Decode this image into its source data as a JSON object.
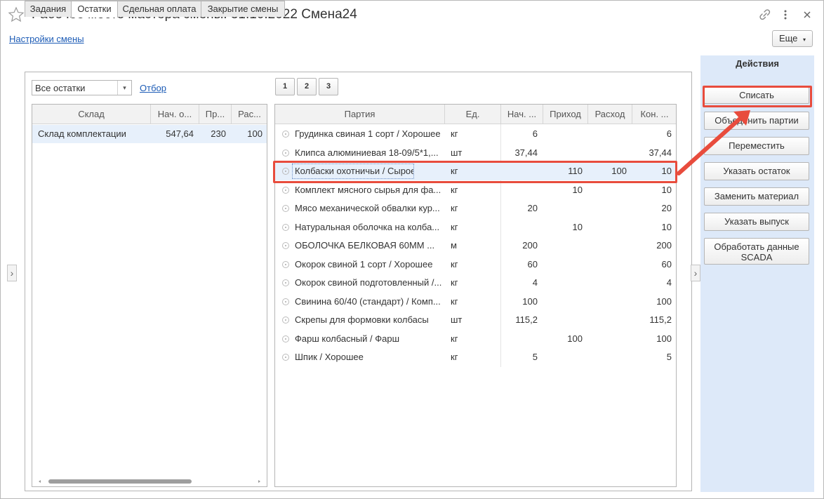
{
  "window": {
    "title": "Рабочее место мастера смены: 31.10.2022 Смена24",
    "settings_link": "Настройки смены",
    "more_button": "Еще",
    "icons": [
      "star-icon",
      "link-icon",
      "more-vertical-icon",
      "close-icon"
    ]
  },
  "tabs": [
    "Задания",
    "Остатки",
    "Сдельная оплата",
    "Закрытие смены"
  ],
  "active_tab": "Остатки",
  "filter": {
    "select_value": "Все остатки",
    "filter_link": "Отбор"
  },
  "pager": [
    "1",
    "2",
    "3"
  ],
  "warehouses": {
    "columns": [
      "Склад",
      "Нач. о...",
      "Пр...",
      "Рас..."
    ],
    "rows": [
      {
        "name": "Склад комплектации",
        "start": "547,64",
        "in": "230",
        "out": "100"
      }
    ]
  },
  "batches": {
    "columns": [
      "Партия",
      "Ед.",
      "Нач. ...",
      "Приход",
      "Расход",
      "Кон. ..."
    ],
    "rows": [
      {
        "name": "Грудинка свиная 1 сорт / Хорошее",
        "unit": "кг",
        "start": "6",
        "in": "",
        "out": "",
        "end": "6"
      },
      {
        "name": "Клипса алюминиевая 18-09/5*1,...",
        "unit": "шт",
        "start": "37,44",
        "in": "",
        "out": "",
        "end": "37,44"
      },
      {
        "name": "Колбаски охотничьи / Сырое",
        "unit": "кг",
        "start": "",
        "in": "110",
        "out": "100",
        "end": "10"
      },
      {
        "name": "Комплект мясного сырья для фа...",
        "unit": "кг",
        "start": "",
        "in": "10",
        "out": "",
        "end": "10"
      },
      {
        "name": "Мясо механической обвалки кур...",
        "unit": "кг",
        "start": "20",
        "in": "",
        "out": "",
        "end": "20"
      },
      {
        "name": "Натуральная оболочка на колба...",
        "unit": "кг",
        "start": "",
        "in": "10",
        "out": "",
        "end": "10"
      },
      {
        "name": "ОБОЛОЧКА БЕЛКОВАЯ 60ММ ...",
        "unit": "м",
        "start": "200",
        "in": "",
        "out": "",
        "end": "200"
      },
      {
        "name": "Окорок свиной 1 сорт / Хорошее",
        "unit": "кг",
        "start": "60",
        "in": "",
        "out": "",
        "end": "60"
      },
      {
        "name": "Окорок свиной подготовленный /...",
        "unit": "кг",
        "start": "4",
        "in": "",
        "out": "",
        "end": "4"
      },
      {
        "name": "Свинина 60/40 (стандарт) / Комп...",
        "unit": "кг",
        "start": "100",
        "in": "",
        "out": "",
        "end": "100"
      },
      {
        "name": "Скрепы для формовки колбасы",
        "unit": "шт",
        "start": "115,2",
        "in": "",
        "out": "",
        "end": "115,2"
      },
      {
        "name": "Фарш колбасный / Фарш",
        "unit": "кг",
        "start": "",
        "in": "100",
        "out": "",
        "end": "100"
      },
      {
        "name": "Шпик / Хорошее",
        "unit": "кг",
        "start": "5",
        "in": "",
        "out": "",
        "end": "5"
      }
    ],
    "selected_row": 2
  },
  "actions": {
    "title": "Действия",
    "buttons": [
      "Списать",
      "Объединить партии",
      "Переместить",
      "Указать остаток",
      "Заменить материал",
      "Указать выпуск",
      "Обработать данные SCADA"
    ]
  },
  "colors": {
    "accent_link": "#1d5cb6",
    "selection": "#e7f0fb",
    "actions_bg": "#dde9f9",
    "highlight_red": "#e84c3d"
  }
}
